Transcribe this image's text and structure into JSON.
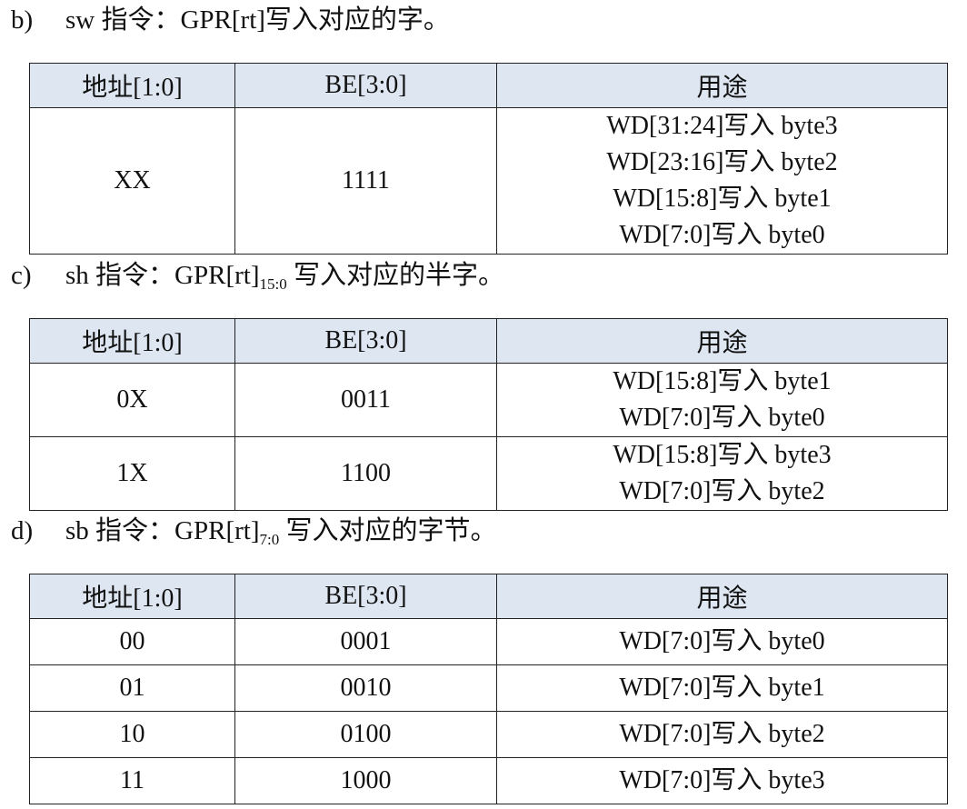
{
  "header": {
    "addr": "地址[1:0]",
    "be": "BE[3:0]",
    "use": "用途"
  },
  "sections": [
    {
      "label": "b)",
      "text": "sw 指令：GPR[rt]写入对应的字。",
      "rows": [
        {
          "addr": "XX",
          "be": "1111",
          "uses": [
            "WD[31:24]写入 byte3",
            "WD[23:16]写入 byte2",
            "WD[15:8]写入 byte1",
            "WD[7:0]写入 byte0"
          ]
        }
      ]
    },
    {
      "label": "c)",
      "text_pre": "sh 指令：GPR[rt]",
      "text_sub": "15:0",
      "text_post": " 写入对应的半字。",
      "rows": [
        {
          "addr": "0X",
          "be": "0011",
          "uses": [
            "WD[15:8]写入 byte1",
            "WD[7:0]写入 byte0"
          ]
        },
        {
          "addr": "1X",
          "be": "1100",
          "uses": [
            "WD[15:8]写入 byte3",
            "WD[7:0]写入 byte2"
          ]
        }
      ]
    },
    {
      "label": "d)",
      "text_pre": "sb 指令：GPR[rt]",
      "text_sub": "7:0",
      "text_post": " 写入对应的字节。",
      "rows": [
        {
          "addr": "00",
          "be": "0001",
          "uses": [
            "WD[7:0]写入 byte0"
          ]
        },
        {
          "addr": "01",
          "be": "0010",
          "uses": [
            "WD[7:0]写入 byte1"
          ]
        },
        {
          "addr": "10",
          "be": "0100",
          "uses": [
            "WD[7:0]写入 byte2"
          ]
        },
        {
          "addr": "11",
          "be": "1000",
          "uses": [
            "WD[7:0]写入 byte3"
          ]
        }
      ]
    }
  ]
}
